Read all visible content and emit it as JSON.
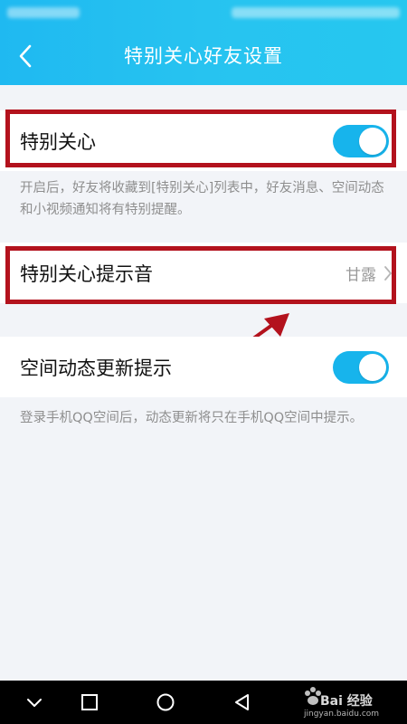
{
  "header": {
    "title": "特别关心好友设置"
  },
  "settings": {
    "special_care": {
      "label": "特别关心",
      "enabled": true,
      "description": "开启后，好友将收藏到[特别关心]列表中，好友消息、空间动态和小视频通知将有特别提醒。"
    },
    "special_care_sound": {
      "label": "特别关心提示音",
      "value": "甘露"
    },
    "qzone_update": {
      "label": "空间动态更新提示",
      "enabled": true,
      "description": "登录手机QQ空间后，动态更新将只在手机QQ空间中提示。"
    }
  },
  "watermark": {
    "brand": "Bai 经验",
    "url": "jingyan.baidu.com"
  },
  "colors": {
    "header": "#26c3f0",
    "toggle_on": "#17b4ec",
    "highlight": "#b3121d",
    "background": "#f2f4f8"
  },
  "icons": {
    "back": "chevron-left-icon",
    "nav": [
      "chevron-down-icon",
      "square-icon",
      "circle-icon",
      "triangle-back-icon"
    ]
  }
}
